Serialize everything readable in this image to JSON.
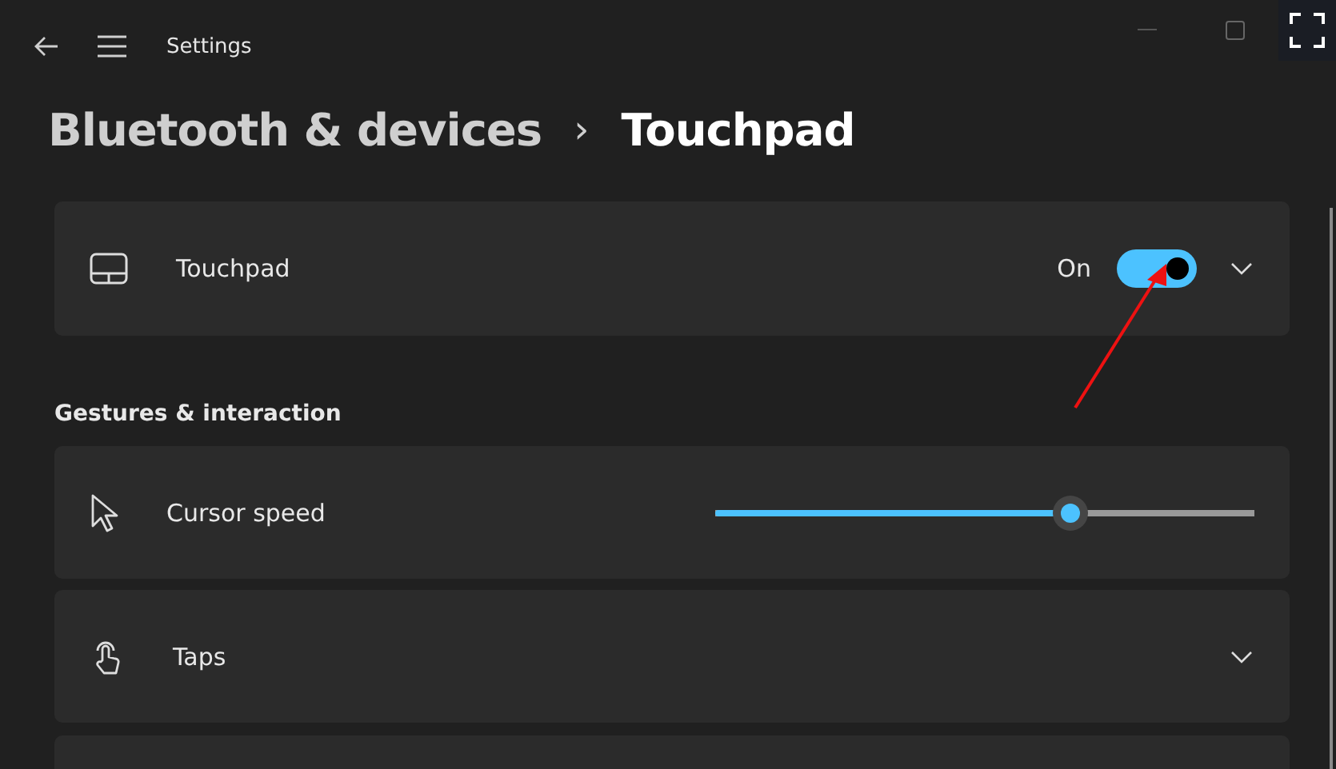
{
  "window": {
    "title": "Settings"
  },
  "breadcrumb": {
    "parent": "Bluetooth & devices",
    "separator": "›",
    "current": "Touchpad"
  },
  "touchpad": {
    "label": "Touchpad",
    "state_label": "On",
    "on": true,
    "expanded": false
  },
  "section": {
    "title": "Gestures & interaction"
  },
  "rows": [
    {
      "kind": "slider",
      "label": "Cursor speed",
      "level": 0.66
    },
    {
      "kind": "expander",
      "label": "Taps",
      "expanded": false
    }
  ]
}
